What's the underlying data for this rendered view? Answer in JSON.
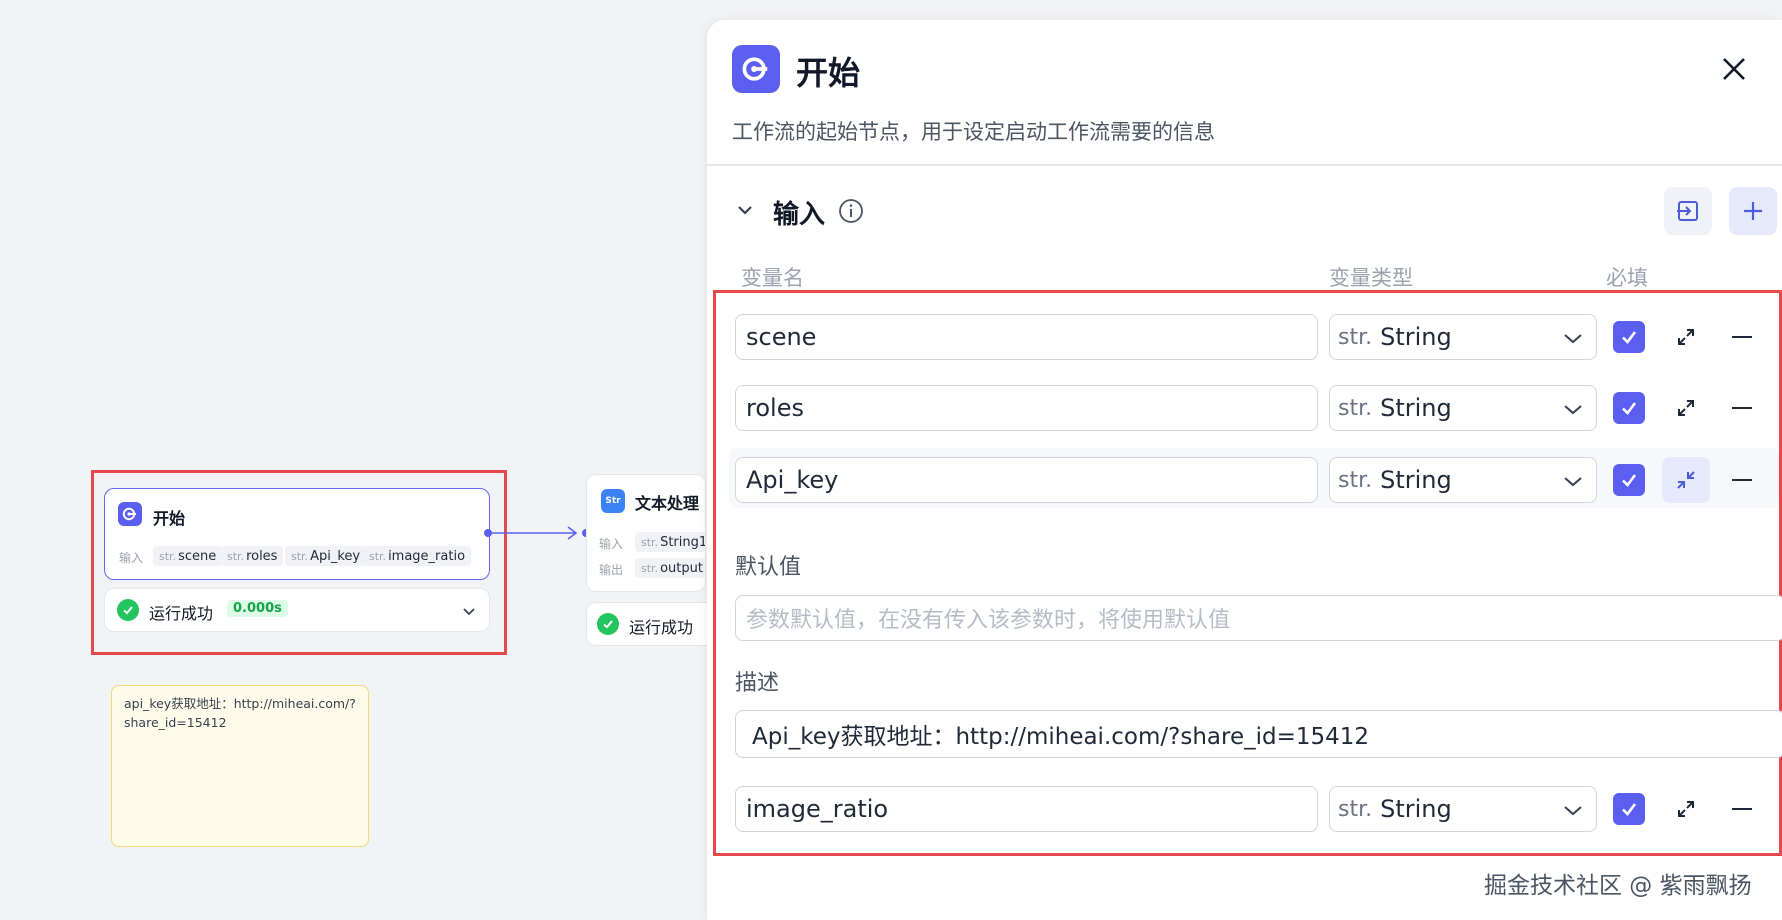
{
  "canvas": {
    "start_node": {
      "title": "开始",
      "inputs_label": "输入",
      "inputs": [
        {
          "type": "str.",
          "name": "scene"
        },
        {
          "type": "str.",
          "name": "roles"
        },
        {
          "type": "str.",
          "name": "Api_key"
        },
        {
          "type": "str.",
          "name": "image_ratio"
        }
      ],
      "status": "运行成功",
      "time": "0.000s"
    },
    "text_node": {
      "title": "文本处理",
      "input_label": "输入",
      "input_type": "str.",
      "input_name": "String1",
      "output_label": "输出",
      "output_type": "str.",
      "output_name": "output",
      "status": "运行成功"
    },
    "note": {
      "text": "api_key获取地址：http://miheai.com/?share_id=15412"
    }
  },
  "panel": {
    "title": "开始",
    "description": "工作流的起始节点，用于设定启动工作流需要的信息",
    "section_title": "输入",
    "columns": {
      "name": "变量名",
      "type": "变量类型",
      "required": "必填"
    },
    "variables": [
      {
        "name": "scene",
        "type_prefix": "str.",
        "type": "String",
        "required": true
      },
      {
        "name": "roles",
        "type_prefix": "str.",
        "type": "String",
        "required": true
      },
      {
        "name": "Api_key",
        "type_prefix": "str.",
        "type": "String",
        "required": true,
        "expanded": true
      },
      {
        "name": "image_ratio",
        "type_prefix": "str.",
        "type": "String",
        "required": true
      }
    ],
    "expanded_detail": {
      "default_label": "默认值",
      "default_placeholder": "参数默认值，在没有传入该参数时，将使用默认值",
      "desc_label": "描述",
      "desc_value": "Api_key获取地址：http://miheai.com/?share_id=15412"
    }
  },
  "watermark": "掘金技术社区 @ 紫雨飘扬",
  "colors": {
    "accent": "#5b5ff0",
    "success": "#22c55e",
    "highlight_border": "#e5484d",
    "note_bg": "#fffbea"
  }
}
